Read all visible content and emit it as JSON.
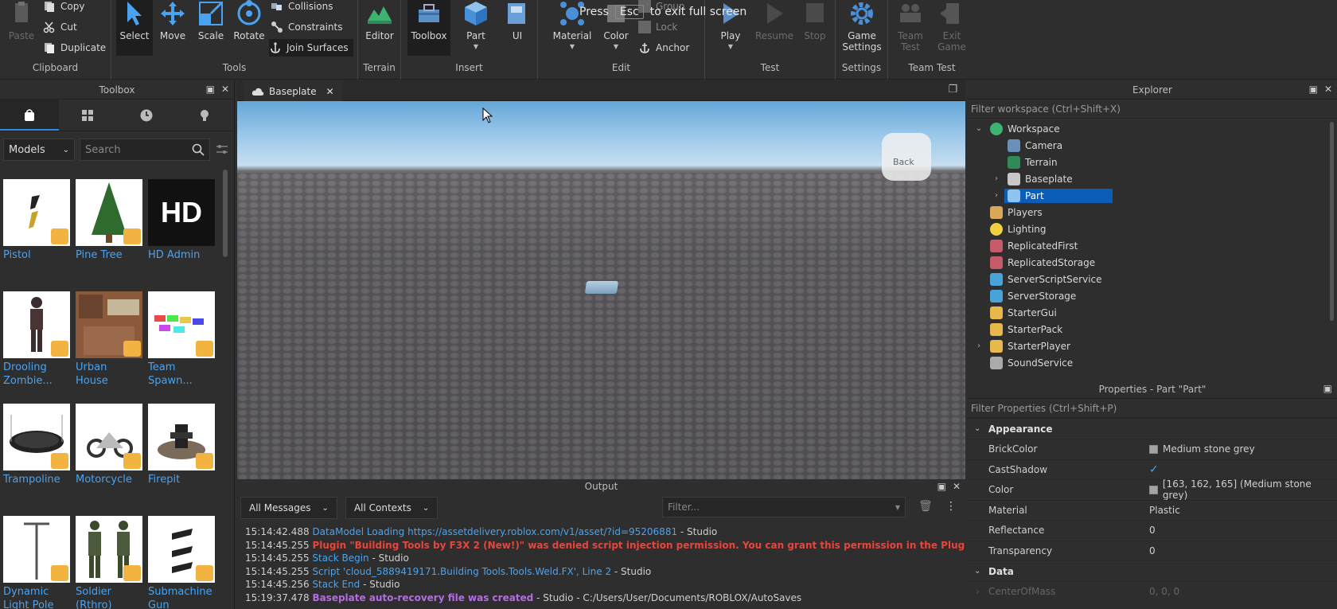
{
  "fullscreen_notice": {
    "pre": "Press",
    "key": "Esc",
    "post": "to exit full screen"
  },
  "ribbon": {
    "clipboard": {
      "label": "Clipboard",
      "paste": "Paste",
      "copy": "Copy",
      "cut": "Cut",
      "duplicate": "Duplicate"
    },
    "tools": {
      "label": "Tools",
      "select": "Select",
      "move": "Move",
      "scale": "Scale",
      "rotate": "Rotate",
      "collisions": "Collisions",
      "constraints": "Constraints",
      "join_surfaces": "Join Surfaces"
    },
    "terrain": {
      "label": "Terrain",
      "editor": "Editor"
    },
    "insert": {
      "label": "Insert",
      "toolbox": "Toolbox",
      "part": "Part",
      "ui": "UI"
    },
    "edit": {
      "label": "Edit",
      "material": "Material",
      "color": "Color",
      "group": "Group",
      "lock": "Lock",
      "anchor": "Anchor"
    },
    "test": {
      "label": "Test",
      "play": "Play",
      "resume": "Resume",
      "stop": "Stop"
    },
    "settings": {
      "label": "Settings",
      "game_settings_1": "Game",
      "game_settings_2": "Settings"
    },
    "team_test": {
      "label": "Team Test",
      "team_test_1": "Team",
      "team_test_2": "Test",
      "exit_game_1": "Exit",
      "exit_game_2": "Game"
    }
  },
  "toolbox": {
    "title": "Toolbox",
    "category": "Models",
    "search_placeholder": "Search",
    "items": [
      {
        "name": "Pistol"
      },
      {
        "name": "Pine Tree"
      },
      {
        "name": "HD Admin",
        "thumb_text": "HD"
      },
      {
        "name": "Drooling Zombie..."
      },
      {
        "name": "Urban House"
      },
      {
        "name": "Team Spawn..."
      },
      {
        "name": "Trampoline"
      },
      {
        "name": "Motorcycle"
      },
      {
        "name": "Firepit"
      },
      {
        "name": "Dynamic Light Pole"
      },
      {
        "name": "Soldier (Rthro)"
      },
      {
        "name": "Submachine Gun"
      }
    ]
  },
  "document": {
    "tab_label": "Baseplate",
    "viewcube_label": "Back"
  },
  "output": {
    "title": "Output",
    "messages_filter": "All Messages",
    "contexts_filter": "All Contexts",
    "filter_placeholder": "Filter...",
    "logs": [
      {
        "time": "15:14:42.488",
        "msg": "DataModel Loading https://assetdelivery.roblox.com/v1/asset/?id=95206881",
        "src": " - Studio",
        "kind": "msg"
      },
      {
        "time": "15:14:45.255",
        "msg": "Plugin \"Building Tools by F3X 2 (New!)\" was denied script injection permission. You can grant this permission in the Plugin Manager.",
        "src": " - Studio",
        "kind": "warn"
      },
      {
        "time": "15:14:45.255",
        "msg": "Stack Begin",
        "src": " - Studio",
        "kind": "msg"
      },
      {
        "time": "15:14:45.255",
        "msg": "Script 'cloud_5889419171.Building Tools.Tools.Weld.FX', Line 2",
        "src": " - Studio",
        "kind": "msg"
      },
      {
        "time": "15:14:45.256",
        "msg": "Stack End",
        "src": " - Studio",
        "kind": "msg"
      },
      {
        "time": "15:19:37.478",
        "msg": "Baseplate auto-recovery file was created",
        "src": " - Studio - C:/Users/User/Documents/ROBLOX/AutoSaves",
        "kind": "purple"
      }
    ]
  },
  "explorer": {
    "title": "Explorer",
    "filter_placeholder": "Filter workspace (Ctrl+Shift+X)",
    "items": [
      {
        "label": "Workspace"
      },
      {
        "label": "Camera"
      },
      {
        "label": "Terrain"
      },
      {
        "label": "Baseplate"
      },
      {
        "label": "Part"
      },
      {
        "label": "Players"
      },
      {
        "label": "Lighting"
      },
      {
        "label": "ReplicatedFirst"
      },
      {
        "label": "ReplicatedStorage"
      },
      {
        "label": "ServerScriptService"
      },
      {
        "label": "ServerStorage"
      },
      {
        "label": "StarterGui"
      },
      {
        "label": "StarterPack"
      },
      {
        "label": "StarterPlayer"
      },
      {
        "label": "SoundService"
      }
    ]
  },
  "properties": {
    "title": "Properties - Part \"Part\"",
    "filter_placeholder": "Filter Properties (Ctrl+Shift+P)",
    "cat_appearance": "Appearance",
    "cat_data": "Data",
    "rows": [
      {
        "name": "BrickColor",
        "value": "Medium stone grey"
      },
      {
        "name": "CastShadow",
        "value": "✓"
      },
      {
        "name": "Color",
        "value": "[163, 162, 165] (Medium stone grey)"
      },
      {
        "name": "Material",
        "value": "Plastic"
      },
      {
        "name": "Reflectance",
        "value": "0"
      },
      {
        "name": "Transparency",
        "value": "0"
      }
    ],
    "data_rows": [
      {
        "name": "CenterOfMass",
        "value": "0, 0, 0"
      }
    ]
  },
  "colors": {
    "accent": "#2f8ae0",
    "selection": "#0b5db8",
    "link": "#4aa3f0",
    "error": "#e8453c"
  }
}
